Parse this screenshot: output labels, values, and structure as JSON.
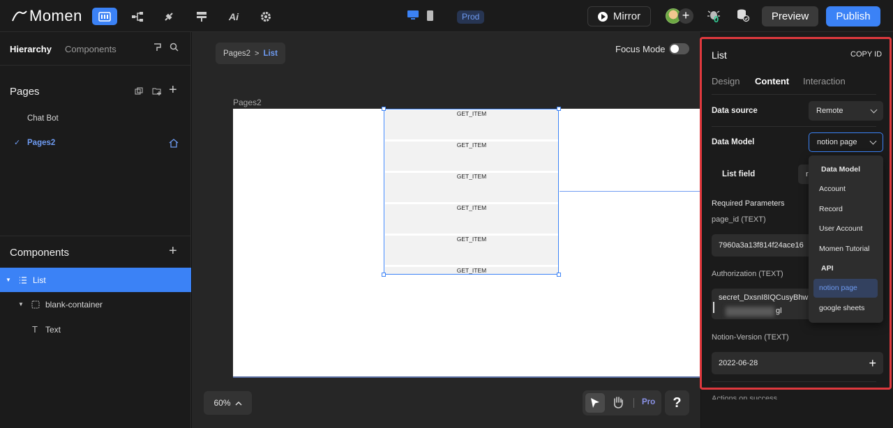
{
  "topbar": {
    "logo_text": "Momen",
    "env_badge": "Prod",
    "mirror_label": "Mirror",
    "bug_count": "0",
    "preview_label": "Preview",
    "publish_label": "Publish",
    "accent": "#3b82f6"
  },
  "leftbar": {
    "tabs": [
      "Hierarchy",
      "Components"
    ],
    "pages_title": "Pages",
    "pages": [
      "Chat Bot",
      "Pages2"
    ],
    "components_title": "Components",
    "tree": [
      "List",
      "blank-container",
      "Text"
    ]
  },
  "canvas": {
    "breadcrumb": [
      "Pages2",
      "List"
    ],
    "focus_mode_label": "Focus Mode",
    "page_label": "Pages2",
    "list_rows": [
      "GET_ITEM",
      "GET_ITEM",
      "GET_ITEM",
      "GET_ITEM",
      "GET_ITEM",
      "GET_ITEM"
    ],
    "zoom": "60%",
    "pro_label": "Pro",
    "help_label": "?"
  },
  "panel": {
    "title": "List",
    "copy_id": "COPY ID",
    "tabs": [
      "Design",
      "Content",
      "Interaction"
    ],
    "data_source_label": "Data source",
    "data_source_value": "Remote",
    "data_model_label": "Data Model",
    "data_model_value": "notion page",
    "list_field_label": "List field",
    "list_field_value": "r",
    "required_params_label": "Required Parameters",
    "param1_label": "page_id (TEXT)",
    "param1_value": "7960a3a13f814f24ace16",
    "param2_label": "Authorization (TEXT)",
    "param2_value_line1": "secret_DxsnI8IQCusyBhw",
    "param2_value_line2": "gl",
    "param3_label": "Notion-Version (TEXT)",
    "param3_value": "2022-06-28",
    "actions_label": "Actions on success",
    "dropdown": {
      "header": "Data Model",
      "options": [
        "Account",
        "Record",
        "User Account",
        "Momen Tutorial"
      ],
      "group": "API",
      "group_options": [
        "notion page",
        "google sheets"
      ]
    },
    "highlight_color": "#e0393e"
  }
}
